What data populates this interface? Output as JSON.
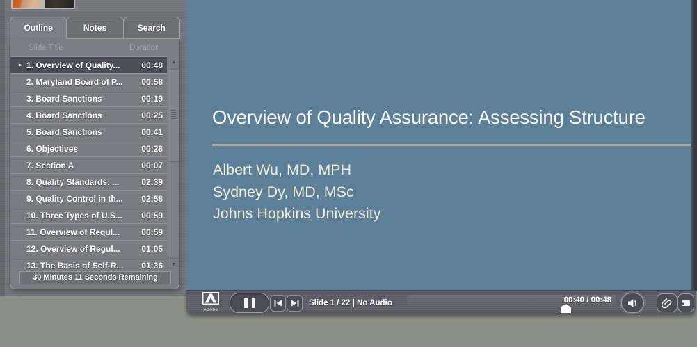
{
  "colors": {
    "page_bg": "#8b8e85",
    "slide_bg": "#5d8099",
    "slide_rule": "#b3ab90",
    "slide_title_text": "#f7f8f4",
    "slide_author_text": "#f0e9d2",
    "selected_row_bg": "#4c4d56",
    "chrome_gray": "#75767d",
    "control_bar": "#5b5c63"
  },
  "sidebar": {
    "tabs": [
      {
        "label": "Outline",
        "active": true
      },
      {
        "label": "Notes",
        "active": false
      },
      {
        "label": "Search",
        "active": false
      }
    ],
    "columns": {
      "title": "Slide Title",
      "duration": "Duration"
    },
    "current_marker": "▸",
    "scrollbar": {
      "up": "▲",
      "down": "▼"
    },
    "slides": [
      {
        "title": "1. Overview of Quality...",
        "duration": "00:48",
        "current": true
      },
      {
        "title": "2. Maryland Board of P...",
        "duration": "00:58"
      },
      {
        "title": "3. Board Sanctions",
        "duration": "00:19"
      },
      {
        "title": "4. Board Sanctions",
        "duration": "00:25"
      },
      {
        "title": "5. Board Sanctions",
        "duration": "00:41"
      },
      {
        "title": "6. Objectives",
        "duration": "00:28"
      },
      {
        "title": "7. Section A",
        "duration": "00:07"
      },
      {
        "title": "8. Quality Standards: ...",
        "duration": "02:39"
      },
      {
        "title": "9. Quality Control in th...",
        "duration": "02:58"
      },
      {
        "title": "10. Three Types of U.S...",
        "duration": "00:59"
      },
      {
        "title": "11. Overview of Regul...",
        "duration": "00:59"
      },
      {
        "title": "12. Overview of Regul...",
        "duration": "01:05"
      },
      {
        "title": "13. The Basis of Self-R...",
        "duration": "01:36"
      }
    ],
    "remaining": "30 Minutes 11 Seconds Remaining"
  },
  "slide": {
    "title": "Overview of Quality Assurance: Assessing Structure",
    "authors": [
      "Albert Wu, MD, MPH",
      "Sydney Dy, MD, MSc",
      "Johns Hopkins University"
    ]
  },
  "controls": {
    "brand": "Adobe",
    "slide_status": "Slide 1 / 22 | No Audio",
    "time": "00:40 / 00:48"
  }
}
